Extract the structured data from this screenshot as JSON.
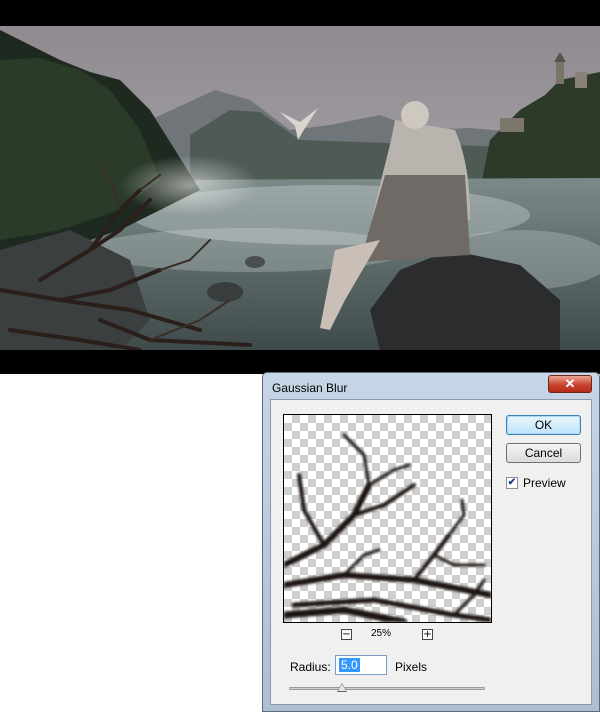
{
  "dialog": {
    "title": "Gaussian Blur",
    "close_glyph": "✕",
    "ok_label": "OK",
    "cancel_label": "Cancel",
    "preview_label": "Preview",
    "preview_checked": true,
    "zoom_out_glyph": "−",
    "zoom_in_glyph": "+",
    "zoom_level": "25%",
    "radius_label": "Radius:",
    "radius_value": "5.0",
    "units_label": "Pixels",
    "slider_fraction": 0.27
  },
  "colors": {
    "close_button": "#c8452f",
    "ok_button": "#bfe3fa",
    "selection": "#3399ff",
    "window_frame": "#aebfd3"
  },
  "icons": {
    "close": "close-icon",
    "zoom_out": "minus-icon",
    "zoom_in": "plus-icon",
    "check": "checkmark-icon"
  }
}
